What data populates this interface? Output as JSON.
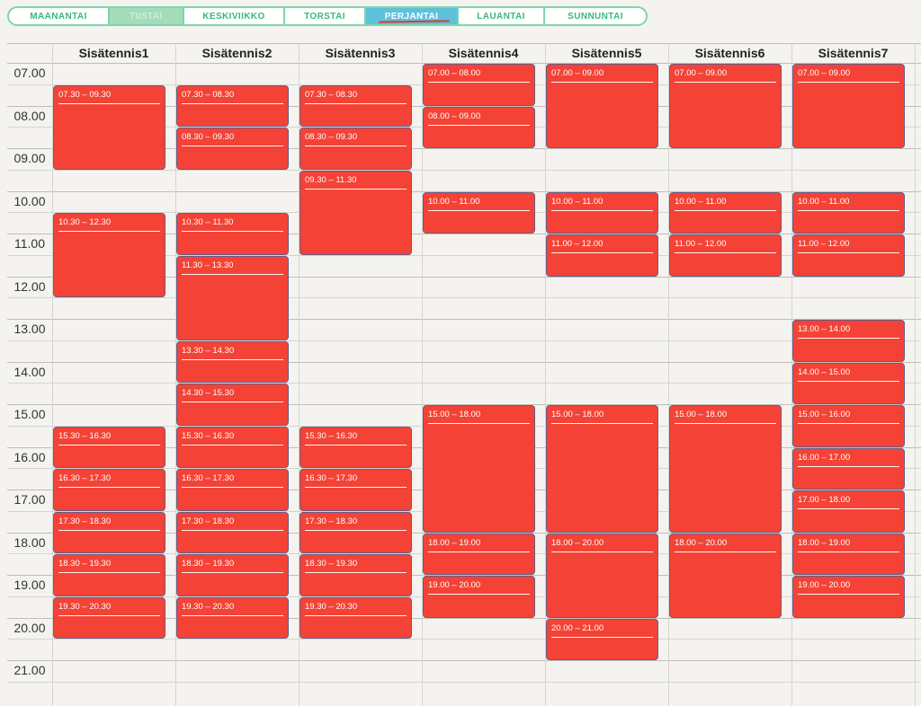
{
  "days": [
    {
      "label": "MAANANTAI",
      "state": "normal"
    },
    {
      "label": "TIISTAI",
      "state": "dim"
    },
    {
      "label": "KESKIVIIKKO",
      "state": "normal"
    },
    {
      "label": "TORSTAI",
      "state": "normal"
    },
    {
      "label": "PERJANTAI",
      "state": "active"
    },
    {
      "label": "LAUANTAI",
      "state": "normal"
    },
    {
      "label": "SUNNUNTAI",
      "state": "normal"
    }
  ],
  "courts": [
    "Sisätennis1",
    "Sisätennis2",
    "Sisätennis3",
    "Sisätennis4",
    "Sisätennis5",
    "Sisätennis6",
    "Sisätennis7"
  ],
  "hours": [
    "07.00",
    "08.00",
    "09.00",
    "10.00",
    "11.00",
    "12.00",
    "13.00",
    "14.00",
    "15.00",
    "16.00",
    "17.00",
    "18.00",
    "19.00",
    "20.00",
    "21.00"
  ],
  "colors": {
    "booking": "#f44336",
    "tab_border": "#7ed6a8",
    "tab_active": "#5ec1dc"
  },
  "bookings": [
    [
      {
        "label": "07.30 – 09.30",
        "start": 7.5,
        "end": 9.5
      },
      {
        "label": "10.30 – 12.30",
        "start": 10.5,
        "end": 12.5
      },
      {
        "label": "15.30 – 16.30",
        "start": 15.5,
        "end": 16.5
      },
      {
        "label": "16.30 – 17.30",
        "start": 16.5,
        "end": 17.5
      },
      {
        "label": "17.30 – 18.30",
        "start": 17.5,
        "end": 18.5
      },
      {
        "label": "18.30 – 19.30",
        "start": 18.5,
        "end": 19.5
      },
      {
        "label": "19.30 – 20.30",
        "start": 19.5,
        "end": 20.5
      }
    ],
    [
      {
        "label": "07.30 – 08.30",
        "start": 7.5,
        "end": 8.5
      },
      {
        "label": "08.30 – 09.30",
        "start": 8.5,
        "end": 9.5
      },
      {
        "label": "10.30 – 11.30",
        "start": 10.5,
        "end": 11.5
      },
      {
        "label": "11.30 – 13.30",
        "start": 11.5,
        "end": 13.5
      },
      {
        "label": "13.30 – 14.30",
        "start": 13.5,
        "end": 14.5
      },
      {
        "label": "14.30 – 15.30",
        "start": 14.5,
        "end": 15.5
      },
      {
        "label": "15.30 – 16.30",
        "start": 15.5,
        "end": 16.5
      },
      {
        "label": "16.30 – 17.30",
        "start": 16.5,
        "end": 17.5
      },
      {
        "label": "17.30 – 18.30",
        "start": 17.5,
        "end": 18.5
      },
      {
        "label": "18.30 – 19.30",
        "start": 18.5,
        "end": 19.5
      },
      {
        "label": "19.30 – 20.30",
        "start": 19.5,
        "end": 20.5
      }
    ],
    [
      {
        "label": "07.30 – 08.30",
        "start": 7.5,
        "end": 8.5
      },
      {
        "label": "08.30 – 09.30",
        "start": 8.5,
        "end": 9.5
      },
      {
        "label": "09.30 – 11.30",
        "start": 9.5,
        "end": 11.5
      },
      {
        "label": "15.30 – 16.30",
        "start": 15.5,
        "end": 16.5
      },
      {
        "label": "16.30 – 17.30",
        "start": 16.5,
        "end": 17.5
      },
      {
        "label": "17.30 – 18.30",
        "start": 17.5,
        "end": 18.5
      },
      {
        "label": "18.30 – 19.30",
        "start": 18.5,
        "end": 19.5
      },
      {
        "label": "19.30 – 20.30",
        "start": 19.5,
        "end": 20.5
      }
    ],
    [
      {
        "label": "07.00 – 08.00",
        "start": 7,
        "end": 8
      },
      {
        "label": "08.00 – 09.00",
        "start": 8,
        "end": 9
      },
      {
        "label": "10.00 – 11.00",
        "start": 10,
        "end": 11
      },
      {
        "label": "15.00 – 18.00",
        "start": 15,
        "end": 18
      },
      {
        "label": "18.00 – 19.00",
        "start": 18,
        "end": 19
      },
      {
        "label": "19.00 – 20.00",
        "start": 19,
        "end": 20
      }
    ],
    [
      {
        "label": "07.00 – 09.00",
        "start": 7,
        "end": 9
      },
      {
        "label": "10.00 – 11.00",
        "start": 10,
        "end": 11
      },
      {
        "label": "11.00 – 12.00",
        "start": 11,
        "end": 12
      },
      {
        "label": "15.00 – 18.00",
        "start": 15,
        "end": 18
      },
      {
        "label": "18.00 – 20.00",
        "start": 18,
        "end": 20
      },
      {
        "label": "20.00 – 21.00",
        "start": 20,
        "end": 21
      }
    ],
    [
      {
        "label": "07.00 – 09.00",
        "start": 7,
        "end": 9
      },
      {
        "label": "10.00 – 11.00",
        "start": 10,
        "end": 11
      },
      {
        "label": "11.00 – 12.00",
        "start": 11,
        "end": 12
      },
      {
        "label": "15.00 – 18.00",
        "start": 15,
        "end": 18
      },
      {
        "label": "18.00 – 20.00",
        "start": 18,
        "end": 20
      }
    ],
    [
      {
        "label": "07.00 – 09.00",
        "start": 7,
        "end": 9
      },
      {
        "label": "10.00 – 11.00",
        "start": 10,
        "end": 11
      },
      {
        "label": "11.00 – 12.00",
        "start": 11,
        "end": 12
      },
      {
        "label": "13.00 – 14.00",
        "start": 13,
        "end": 14
      },
      {
        "label": "14.00 – 15.00",
        "start": 14,
        "end": 15
      },
      {
        "label": "15.00 – 16.00",
        "start": 15,
        "end": 16
      },
      {
        "label": "16.00 – 17.00",
        "start": 16,
        "end": 17
      },
      {
        "label": "17.00 – 18.00",
        "start": 17,
        "end": 18
      },
      {
        "label": "18.00 – 19.00",
        "start": 18,
        "end": 19
      },
      {
        "label": "19.00 – 20.00",
        "start": 19,
        "end": 20
      }
    ]
  ]
}
